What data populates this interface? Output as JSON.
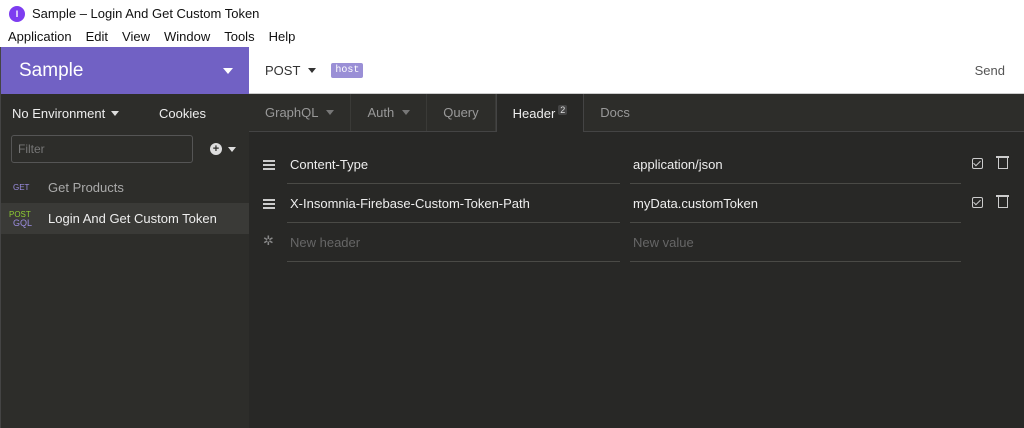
{
  "window": {
    "title": "Sample – Login And Get Custom Token",
    "app_icon_label": "I"
  },
  "menu": [
    "Application",
    "Edit",
    "View",
    "Window",
    "Tools",
    "Help"
  ],
  "sidebar": {
    "workspace": "Sample",
    "environment": "No Environment",
    "cookies": "Cookies",
    "filter_placeholder": "Filter",
    "requests": [
      {
        "method": "GET",
        "name": "Get Products"
      },
      {
        "method_top": "POST",
        "method_bottom": "GQL",
        "name": "Login And Get Custom Token"
      }
    ]
  },
  "urlbar": {
    "method": "POST",
    "host_tag": "host",
    "send": "Send"
  },
  "tabs": [
    {
      "label": "GraphQL"
    },
    {
      "label": "Auth"
    },
    {
      "label": "Query"
    },
    {
      "label": "Header",
      "count": "2"
    },
    {
      "label": "Docs"
    }
  ],
  "headers": [
    {
      "name": "Content-Type",
      "value": "application/json"
    },
    {
      "name": "X-Insomnia-Firebase-Custom-Token-Path",
      "value": "myData.customToken"
    }
  ],
  "new_header": {
    "name_placeholder": "New header",
    "value_placeholder": "New value"
  },
  "colors": {
    "brand": "#7161c4",
    "get": "#9b8de0",
    "post": "#8fce33",
    "background": "#2d2d2a"
  }
}
